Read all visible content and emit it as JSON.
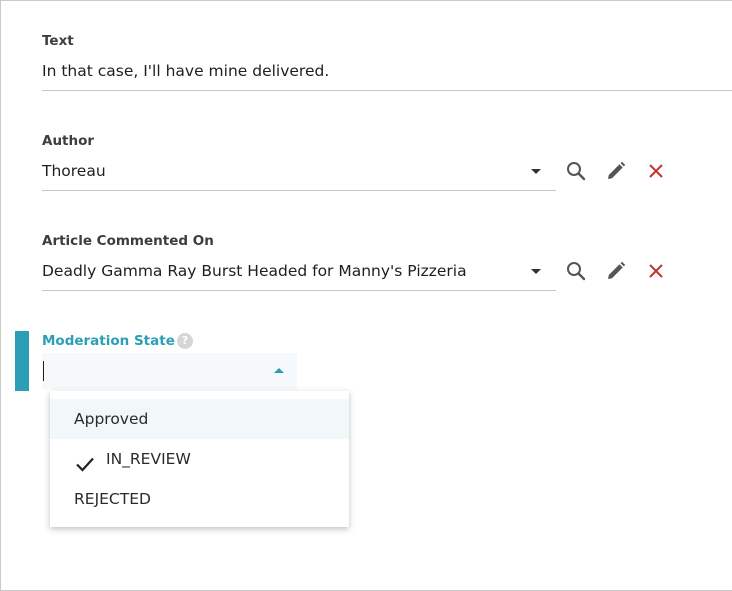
{
  "fields": {
    "text": {
      "label": "Text",
      "value": "In that case, I'll have mine delivered."
    },
    "author": {
      "label": "Author",
      "value": "Thoreau"
    },
    "article": {
      "label": "Article Commented On",
      "value": "Deadly Gamma Ray Burst Headed for Manny's Pizzeria"
    },
    "moderation": {
      "label": "Moderation State",
      "help": "?",
      "value": "",
      "options": [
        {
          "label": "Approved",
          "highlighted": true,
          "checked": false
        },
        {
          "label": "IN_REVIEW",
          "highlighted": false,
          "checked": true
        },
        {
          "label": "REJECTED",
          "highlighted": false,
          "checked": false
        }
      ]
    }
  },
  "icons": {
    "search": "search-icon",
    "edit": "pencil-icon",
    "clear": "close-icon",
    "check": "checkmark-icon",
    "help": "help-icon"
  },
  "colors": {
    "accent": "#2a9fb5",
    "danger": "#c0392b",
    "icon": "#555555"
  }
}
